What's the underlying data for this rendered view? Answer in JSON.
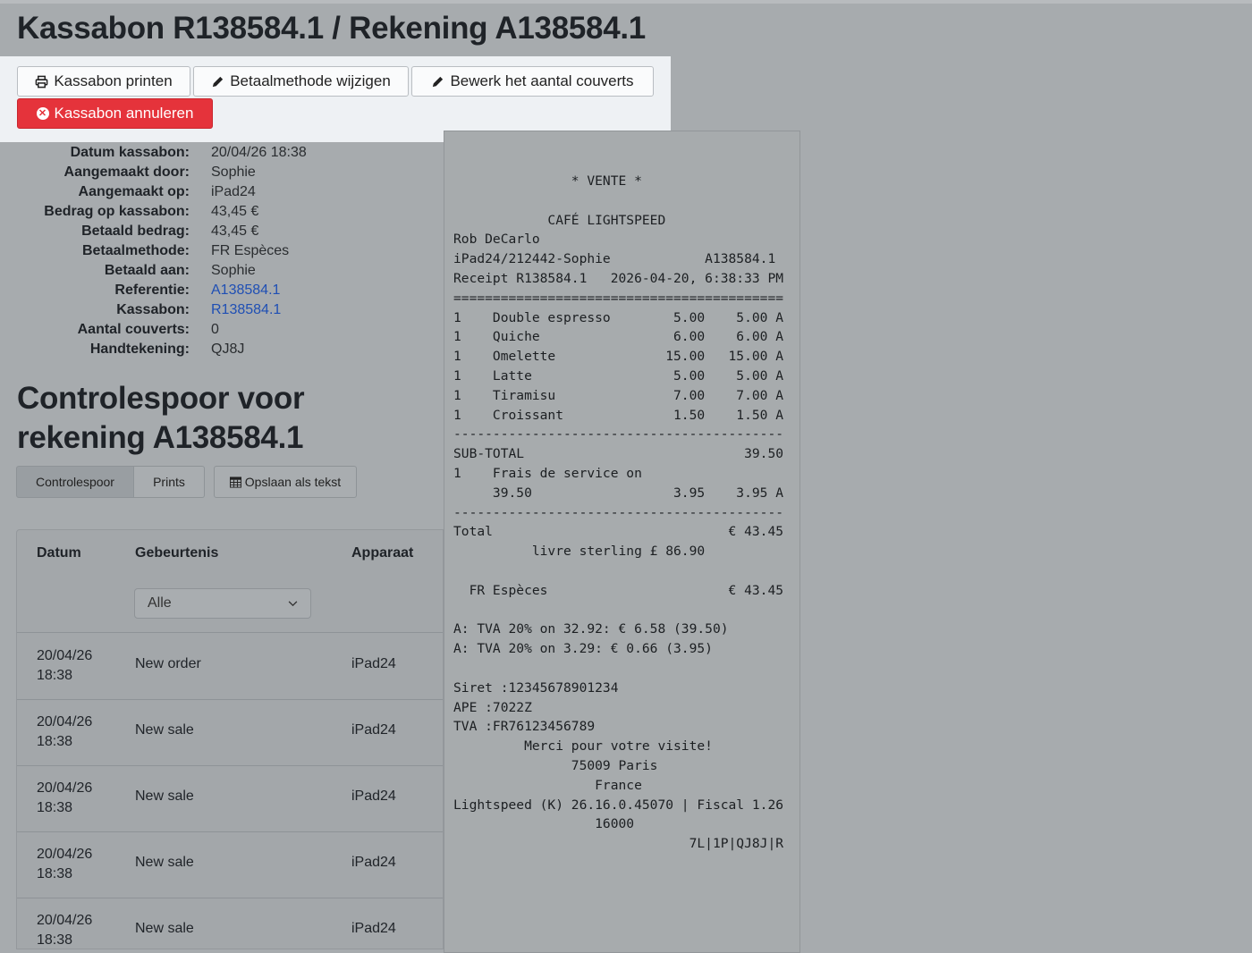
{
  "title": "Kassabon R138584.1 / Rekening A138584.1",
  "actions": {
    "print": "Kassabon printen",
    "change_payment": "Betaalmethode wijzigen",
    "edit_covers": "Bewerk het aantal couverts",
    "cancel_receipt": "Kassabon annuleren"
  },
  "details": {
    "date": {
      "label": "Datum kassabon:",
      "value": "20/04/26 18:38"
    },
    "created_by": {
      "label": "Aangemaakt door:",
      "value": "Sophie"
    },
    "created_on": {
      "label": "Aangemaakt op:",
      "value": "iPad24"
    },
    "receipt_amount": {
      "label": "Bedrag op kassabon:",
      "value": "43,45 €"
    },
    "paid_amount": {
      "label": "Betaald bedrag:",
      "value": "43,45 €"
    },
    "payment_method": {
      "label": "Betaalmethode:",
      "value": "FR Espèces"
    },
    "paid_to": {
      "label": "Betaald aan:",
      "value": "Sophie"
    },
    "reference": {
      "label": "Referentie:",
      "value": "A138584.1"
    },
    "receipt": {
      "label": "Kassabon:",
      "value": "R138584.1"
    },
    "covers": {
      "label": "Aantal couverts:",
      "value": "0"
    },
    "signature": {
      "label": "Handtekening:",
      "value": "QJ8J"
    }
  },
  "audit_title": "Controlespoor voor rekening A138584.1",
  "tabs": {
    "audit": "Controlespoor",
    "prints": "Prints",
    "save_text": "Opslaan als tekst"
  },
  "table": {
    "headers": {
      "date": "Datum",
      "event": "Gebeurtenis",
      "device": "Apparaat"
    },
    "filter": "Alle",
    "rows": [
      {
        "date": "20/04/26",
        "time": "18:38",
        "event": "New order",
        "device": "iPad24"
      },
      {
        "date": "20/04/26",
        "time": "18:38",
        "event": "New sale",
        "device": "iPad24"
      },
      {
        "date": "20/04/26",
        "time": "18:38",
        "event": "New sale",
        "device": "iPad24"
      },
      {
        "date": "20/04/26",
        "time": "18:38",
        "event": "New sale",
        "device": "iPad24"
      },
      {
        "date": "20/04/26",
        "time": "18:38",
        "event": "New sale",
        "device": "iPad24"
      }
    ]
  },
  "receipt_text": "               * VENTE *\n\n            CAFÉ LIGHTSPEED\nRob DeCarlo\niPad24/212442-Sophie            A138584.1\nReceipt R138584.1   2026-04-20, 6:38:33 PM\n==========================================\n1    Double espresso        5.00    5.00 A\n1    Quiche                 6.00    6.00 A\n1    Omelette              15.00   15.00 A\n1    Latte                  5.00    5.00 A\n1    Tiramisu               7.00    7.00 A\n1    Croissant              1.50    1.50 A\n------------------------------------------\nSUB-TOTAL                            39.50\n1    Frais de service on\n     39.50                  3.95    3.95 A\n------------------------------------------\nTotal                              € 43.45\n          livre sterling £ 86.90\n\n  FR Espèces                       € 43.45\n\nA: TVA 20% on 32.92: € 6.58 (39.50)\nA: TVA 20% on 3.29: € 0.66 (3.95)\n\nSiret :12345678901234\nAPE :7022Z\nTVA :FR76123456789\n         Merci pour votre visite!\n               75009 Paris\n                  France\nLightspeed (K) 26.16.0.45070 | Fiscal 1.26\n                  16000\n                              7L|1P|QJ8J|R"
}
